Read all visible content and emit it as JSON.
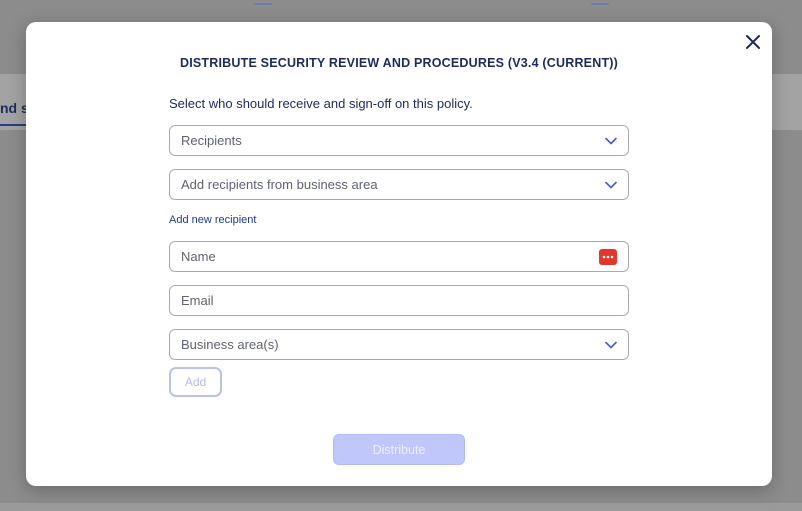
{
  "background": {
    "tab_label_fragment": "nd si"
  },
  "modal": {
    "title": "DISTRIBUTE SECURITY REVIEW AND PROCEDURES (V3.4 (CURRENT))",
    "instructions": "Select who should receive and sign-off on this policy.",
    "recipients_select": {
      "placeholder": "Recipients",
      "icon": "chevron-down-icon"
    },
    "business_area_select": {
      "placeholder": "Add recipients from business area",
      "icon": "chevron-down-icon"
    },
    "add_new_recipient_link": "Add new recipient",
    "name_field": {
      "placeholder": "Name",
      "value": ""
    },
    "email_field": {
      "placeholder": "Email",
      "value": ""
    },
    "business_areas_select": {
      "placeholder": "Business area(s)",
      "icon": "chevron-down-icon"
    },
    "add_button": "Add",
    "distribute_button": "Distribute",
    "close_icon": "close-icon"
  },
  "colors": {
    "primary_text": "#1d2a5c",
    "accent": "#4a5cc9",
    "button_disabled_bg": "#c0c7fb",
    "password_manager_icon": "#e2372b"
  }
}
